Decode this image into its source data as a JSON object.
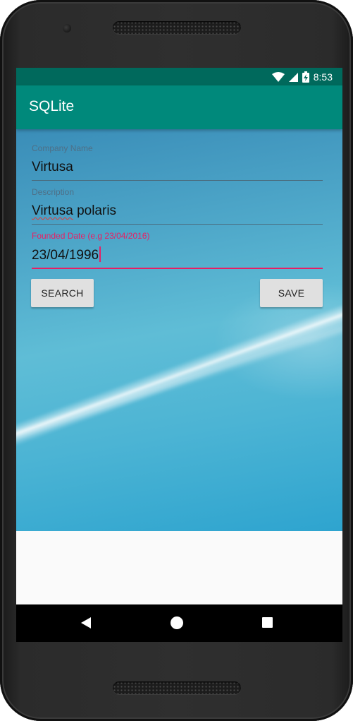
{
  "status_bar": {
    "time": "8:53",
    "icons": [
      "wifi-icon",
      "cell-signal-icon",
      "battery-charging-icon"
    ]
  },
  "app_bar": {
    "title": "SQLite"
  },
  "form": {
    "company_name": {
      "label": "Company Name",
      "value": "Virtusa"
    },
    "description": {
      "label": "Description",
      "value_misspelled": "Virtusa",
      "value_rest": " polaris"
    },
    "founded_date": {
      "label": "Founded Date (e.g 23/04/2016)",
      "value": "23/04/1996"
    }
  },
  "buttons": {
    "search": "SEARCH",
    "save": "SAVE"
  },
  "colors": {
    "primary": "#00897b",
    "primary_dark": "#00695c",
    "accent": "#e91e63"
  },
  "nav_bar": {
    "icons": [
      "back-icon",
      "home-icon",
      "recent-apps-icon"
    ]
  }
}
